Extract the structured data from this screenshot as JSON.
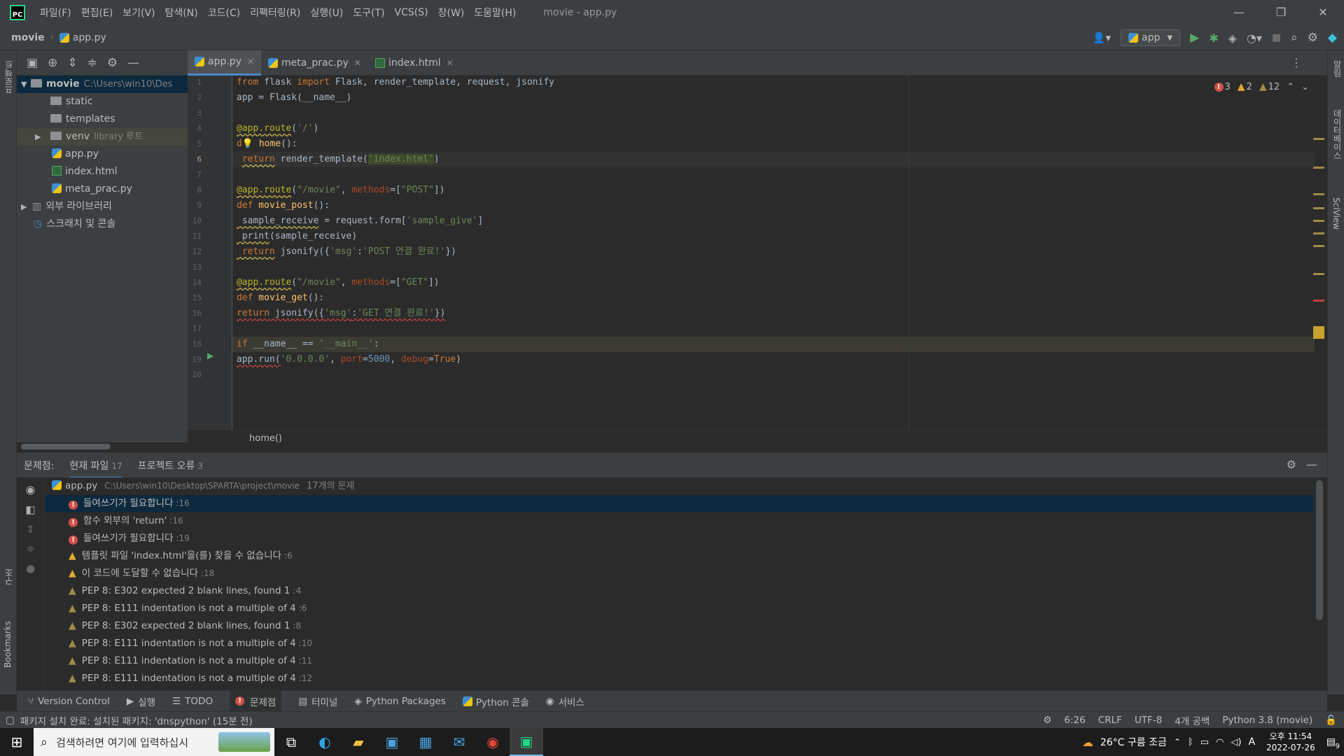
{
  "app": {
    "menu": [
      "파일(F)",
      "편집(E)",
      "보기(V)",
      "탐색(N)",
      "코드(C)",
      "리팩터링(R)",
      "실행(U)",
      "도구(T)",
      "VCS(S)",
      "창(W)",
      "도움말(H)"
    ],
    "window_title": "movie - app.py",
    "logo_text": "PC"
  },
  "navbar": {
    "project": "movie",
    "file": "app.py",
    "run_config": "app"
  },
  "left_stripe": {
    "project_label": "프로젝트",
    "structure_label": "구조",
    "bookmarks_label": "Bookmarks"
  },
  "right_stripe": {
    "notifications": "알림",
    "database": "데이터베이스",
    "sciview": "SciView"
  },
  "project_tree": {
    "root": {
      "name": "movie",
      "path": "C:\\Users\\win10\\Des"
    },
    "items": [
      {
        "name": "static"
      },
      {
        "name": "templates"
      },
      {
        "name": "venv",
        "note": "library 루트"
      },
      {
        "name": "app.py"
      },
      {
        "name": "index.html"
      },
      {
        "name": "meta_prac.py"
      }
    ],
    "external_libs": "외부 라이브러리",
    "scratches": "스크래치 및 콘솔"
  },
  "tabs": [
    {
      "label": "app.py",
      "active": true
    },
    {
      "label": "meta_prac.py",
      "active": false
    },
    {
      "label": "index.html",
      "active": false
    }
  ],
  "inspections": {
    "errors": "3",
    "warnings": "2",
    "weak": "12"
  },
  "line_numbers": [
    "1",
    "2",
    "3",
    "4",
    "5",
    "6",
    "7",
    "8",
    "9",
    "10",
    "11",
    "12",
    "13",
    "14",
    "15",
    "16",
    "17",
    "18",
    "19",
    "20"
  ],
  "code": {
    "l1_from": "from",
    "l1_a": " flask ",
    "l1_import": "import",
    "l1_b": " Flask, render_template, request, jsonify",
    "l2": "app = Flask(__name__)",
    "l4_dec": "@app.route",
    "l4_a": "(",
    "l4_str": "'/'",
    "l4_b": ")",
    "l5_a": "d",
    "l5_fn": "home",
    "l5_b": "():",
    "l6_ret": "return",
    "l6_a": " render_template(",
    "l6_str": "'index.html'",
    "l6_b": ")",
    "l8_dec": "@app.route",
    "l8_a": "(",
    "l8_str": "\"/movie\"",
    "l8_b": ", ",
    "l8_pm": "methods",
    "l8_c": "=[",
    "l8_str2": "\"POST\"",
    "l8_d": "])",
    "l9_def": "def",
    "l9_fn": " movie_post",
    "l9_b": "():",
    "l10_a": " sample_receive",
    "l10_b": " = request.form[",
    "l10_str": "'sample_give'",
    "l10_c": "]",
    "l11_a": " print",
    "l11_b": "(sample_receive)",
    "l12_ret": " return",
    "l12_a": " jsonify({",
    "l12_str": "'msg'",
    "l12_b": ":",
    "l12_str2": "'POST 연결 완료!'",
    "l12_c": "})",
    "l14_dec": "@app.route",
    "l14_a": "(",
    "l14_str": "\"/movie\"",
    "l14_b": ", ",
    "l14_pm": "methods",
    "l14_c": "=[",
    "l14_str2": "\"GET\"",
    "l14_d": "])",
    "l15_def": "def",
    "l15_fn": " movie_get",
    "l15_b": "():",
    "l16_ret": "return",
    "l16_a": " jsonify({",
    "l16_str": "'msg'",
    "l16_b": ":",
    "l16_str2": "'GET 연결 완료!'",
    "l16_c": "})",
    "l18_if": "if",
    "l18_a": " __name__ == ",
    "l18_str": "'__main__'",
    "l18_b": ":",
    "l19_a": "app.run(",
    "l19_str": "'0.0.0.0'",
    "l19_b": ", ",
    "l19_pm": "port",
    "l19_c": "=",
    "l19_num": "5000",
    "l19_d": ", ",
    "l19_pm2": "debug",
    "l19_e": "=",
    "l19_true": "True",
    "l19_f": ")"
  },
  "editor_breadcrumb": "home()",
  "problems": {
    "title": "문제점:",
    "tab_current": "현재 파일",
    "tab_current_count": "17",
    "tab_project": "프로젝트 오류",
    "tab_project_count": "3",
    "file": "app.py",
    "file_path": "C:\\Users\\win10\\Desktop\\SPARTA\\project\\movie",
    "file_count": "17개의 문제",
    "items": [
      {
        "kind": "error",
        "text": "들여쓰기가 필요합니다",
        "line": ":16"
      },
      {
        "kind": "error",
        "text": "함수 외부의 'return'",
        "line": ":16"
      },
      {
        "kind": "error",
        "text": "들여쓰기가 필요합니다",
        "line": ":19"
      },
      {
        "kind": "warning",
        "text": "템플릿 파일 'index.html'을(를) 찾을 수 없습니다",
        "line": ":6"
      },
      {
        "kind": "warning",
        "text": "이 코드에 도달할 수 없습니다",
        "line": ":18"
      },
      {
        "kind": "weak",
        "text": "PEP 8: E302 expected 2 blank lines, found 1",
        "line": ":4"
      },
      {
        "kind": "weak",
        "text": "PEP 8: E111 indentation is not a multiple of 4",
        "line": ":6"
      },
      {
        "kind": "weak",
        "text": "PEP 8: E302 expected 2 blank lines, found 1",
        "line": ":8"
      },
      {
        "kind": "weak",
        "text": "PEP 8: E111 indentation is not a multiple of 4",
        "line": ":10"
      },
      {
        "kind": "weak",
        "text": "PEP 8: E111 indentation is not a multiple of 4",
        "line": ":11"
      },
      {
        "kind": "weak",
        "text": "PEP 8: E111 indentation is not a multiple of 4",
        "line": ":12"
      }
    ]
  },
  "toolwindows": [
    "Version Control",
    "실행",
    "TODO",
    "문제점",
    "터미널",
    "Python Packages",
    "Python 콘솔",
    "서비스"
  ],
  "status": {
    "message": "패키지 설치 완료: 설치된 패키지: 'dnspython' (15분 전)",
    "position": "6:26",
    "line_sep": "CRLF",
    "encoding": "UTF-8",
    "indent": "4개 공백",
    "interpreter": "Python 3.8 (movie)"
  },
  "taskbar": {
    "search_placeholder": "검색하려면 여기에 입력하십시",
    "weather": "26°C 구름 조금",
    "ime": "A",
    "time": "오후 11:54",
    "date": "2022-07-26",
    "notif_count": "9"
  },
  "colors": {
    "accent": "#4a88c7",
    "error": "#d2504a",
    "warning": "#e0a931",
    "bg": "#2b2b2b",
    "panel": "#3c3f41"
  }
}
